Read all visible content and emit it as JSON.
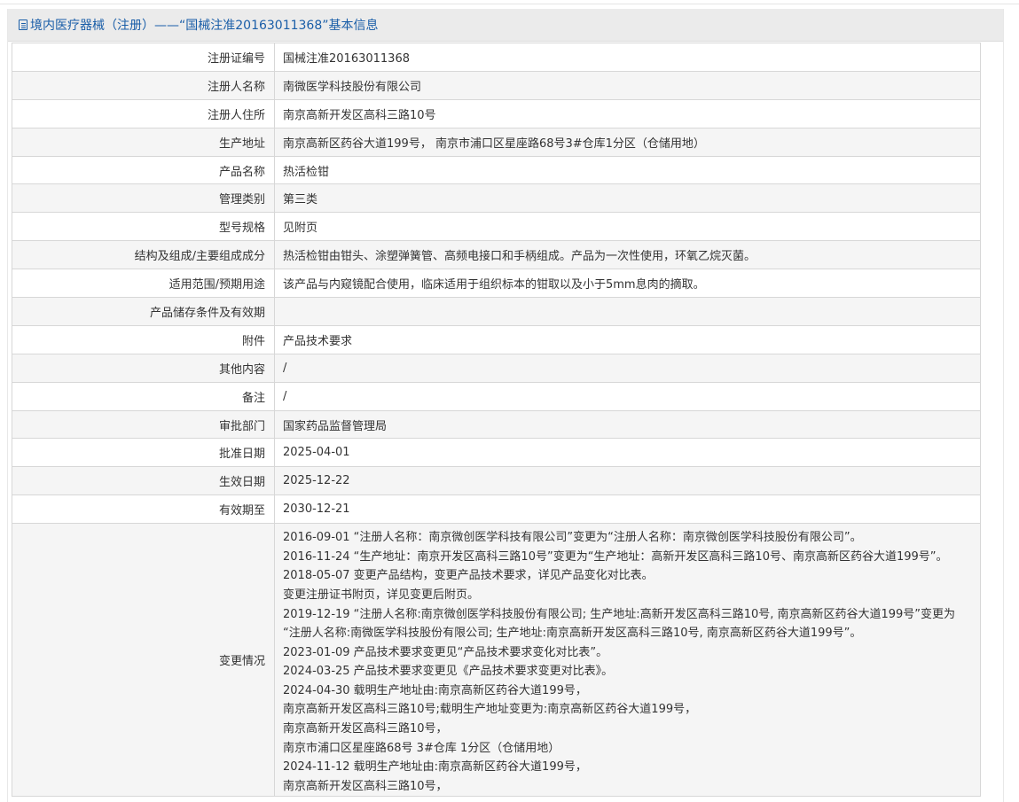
{
  "header": {
    "icon": "document-icon",
    "title": "境内医疗器械（注册）——“国械注准20163011368”基本信息"
  },
  "rows": [
    {
      "label": "注册证编号",
      "value": "国械注准20163011368"
    },
    {
      "label": "注册人名称",
      "value": "南微医学科技股份有限公司"
    },
    {
      "label": "注册人住所",
      "value": "南京高新开发区高科三路10号"
    },
    {
      "label": "生产地址",
      "value": "南京高新区药谷大道199号， 南京市浦口区星座路68号3#仓库1分区（仓储用地）"
    },
    {
      "label": "产品名称",
      "value": "热活检钳"
    },
    {
      "label": "管理类别",
      "value": "第三类"
    },
    {
      "label": "型号规格",
      "value": "见附页"
    },
    {
      "label": "结构及组成/主要组成成分",
      "value": "热活检钳由钳头、涂塑弹簧管、高频电接口和手柄组成。产品为一次性使用，环氧乙烷灭菌。"
    },
    {
      "label": "适用范围/预期用途",
      "value": "该产品与内窥镜配合使用，临床适用于组织标本的钳取以及小于5mm息肉的摘取。"
    },
    {
      "label": "产品储存条件及有效期",
      "value": ""
    },
    {
      "label": "附件",
      "value": "产品技术要求"
    },
    {
      "label": "其他内容",
      "value": "/"
    },
    {
      "label": "备注",
      "value": "/"
    },
    {
      "label": "审批部门",
      "value": "国家药品监督管理局"
    },
    {
      "label": "批准日期",
      "value": "2025-04-01"
    },
    {
      "label": "生效日期",
      "value": "2025-12-22"
    },
    {
      "label": "有效期至",
      "value": "2030-12-21"
    }
  ],
  "changes": {
    "label": "变更情况",
    "lines": [
      "2016-09-01 “注册人名称：南京微创医学科技有限公司”变更为“注册人名称：南京微创医学科技股份有限公司”。",
      "2016-11-24 “生产地址：南京开发区高科三路10号”变更为“生产地址：高新开发区高科三路10号、南京高新区药谷大道199号”。",
      "2018-05-07 变更产品结构，变更产品技术要求，详见产品变化对比表。",
      "变更注册证书附页，详见变更后附页。",
      "2019-12-19 “注册人名称:南京微创医学科技股份有限公司; 生产地址:高新开发区高科三路10号, 南京高新区药谷大道199号”变更为",
      "“注册人名称:南微医学科技股份有限公司; 生产地址:南京高新开发区高科三路10号, 南京高新区药谷大道199号”。",
      "2023-01-09 产品技术要求变更见“产品技术要求变化对比表”。",
      "2024-03-25 产品技术要求变更见《产品技术要求变更对比表》。",
      "2024-04-30 载明生产地址由:南京高新区药谷大道199号，",
      "南京高新开发区高科三路10号;载明生产地址变更为:南京高新区药谷大道199号，",
      "南京高新开发区高科三路10号，",
      "南京市浦口区星座路68号 3#仓库 1分区（仓储用地）",
      "2024-11-12 载明生产地址由:南京高新区药谷大道199号，",
      "南京高新开发区高科三路10号，"
    ]
  }
}
